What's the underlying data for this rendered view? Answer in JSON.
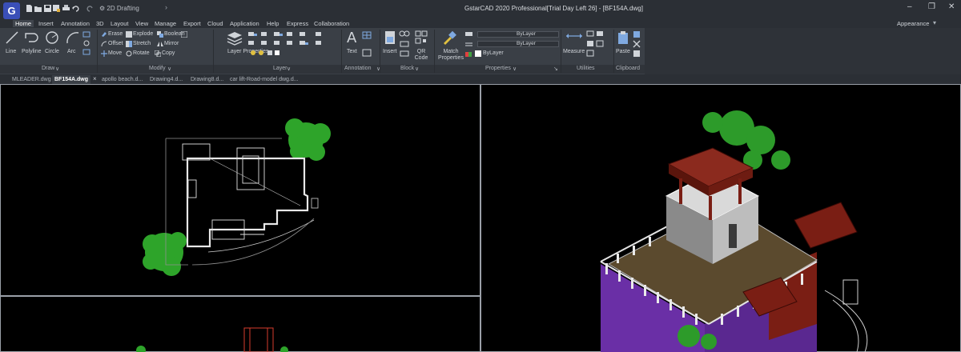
{
  "app": {
    "logo_letter": "G",
    "title": "GstarCAD 2020 Professional[Trial Day Left 26] - [BF154A.dwg]",
    "workspace": "2D Drafting",
    "window_controls": {
      "minimize": "‒",
      "restore": "❐",
      "close": "✕"
    }
  },
  "menu": {
    "items": [
      "Home",
      "Insert",
      "Annotation",
      "3D",
      "Layout",
      "View",
      "Manage",
      "Export",
      "Cloud",
      "Application",
      "Help",
      "Express",
      "Collaboration"
    ],
    "active": "Home",
    "appearance": "Appearance"
  },
  "ribbon": {
    "draw": {
      "line": "Line",
      "polyline": "Polyline",
      "circle": "Circle",
      "arc": "Arc",
      "title": "Draw"
    },
    "modify": {
      "erase": "Erase",
      "explode": "Explode",
      "boolean": "Boolean",
      "offset": "Offset",
      "stretch": "Stretch",
      "mirror": "Mirror",
      "move": "Move",
      "rotate": "Rotate",
      "copy": "Copy",
      "title": "Modify"
    },
    "layer": {
      "layer_properties": "Layer Properties",
      "title": "Layer"
    },
    "annotation": {
      "text": "Text",
      "title": "Annotation"
    },
    "block": {
      "insert": "Insert",
      "qr_code": "QR Code",
      "title": "Block"
    },
    "properties": {
      "match_properties": "Match Properties",
      "color_value": "ByLayer",
      "linetype_value": "ByLayer",
      "lineweight_value": "ByLayer",
      "title": "Properties"
    },
    "utilities": {
      "measure": "Measure",
      "title": "Utilities"
    },
    "clipboard": {
      "paste": "Paste",
      "title": "Clipboard"
    }
  },
  "doc_tabs": {
    "items": [
      "MLEADER.dwg",
      "BF154A.dwg",
      "apollo beach.d...",
      "Drawing4.d...",
      "Drawing8.d...",
      "car lift-Road-model dwg.d..."
    ],
    "active": "BF154A.dwg",
    "close": "×"
  },
  "colors": {
    "titlebar": "#2b2f35",
    "ribbon": "#3a3f46",
    "accent_logo": "#3a4fb8",
    "viewport_bg": "#000000",
    "tree_green": "#2ea42a",
    "building_purple": "#6a2fa6",
    "roof_red": "#7a1e14"
  }
}
